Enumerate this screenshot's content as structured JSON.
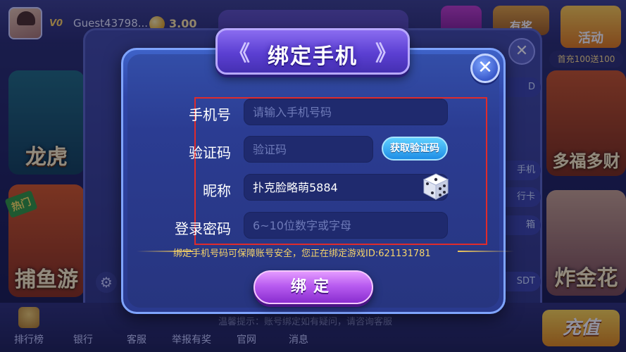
{
  "lobby": {
    "guest_name": "Guest43798...",
    "vip_label": "V0",
    "coins": "3.00",
    "tabs": {
      "activity": "活动",
      "first_recharge": "首充100送100",
      "prize": "有奖"
    },
    "games": {
      "dragon_tiger": "龙虎",
      "fishing": "捕鱼游",
      "fortune": "多福多财",
      "gold_flower": "炸金花",
      "hot_tag": "热门"
    },
    "side_pills": [
      "D",
      "手机",
      "行卡",
      "箱",
      "SDT"
    ],
    "bottom_nav": [
      "排行榜",
      "银行",
      "客服",
      "举报有奖",
      "官网",
      "消息"
    ],
    "recharge": "充值",
    "warm_hint": "温馨提示：账号绑定如有疑问，请咨询客服"
  },
  "dialog": {
    "title": "绑定手机",
    "close_symbol": "✕",
    "fields": {
      "phone": {
        "label": "手机号",
        "placeholder": "请输入手机号码",
        "value": ""
      },
      "code": {
        "label": "验证码",
        "placeholder": "验证码",
        "value": ""
      },
      "nickname": {
        "label": "昵称",
        "value": "扑克脸略萌5884"
      },
      "password": {
        "label": "登录密码",
        "placeholder": "6~10位数字或字母",
        "value": ""
      }
    },
    "get_code_button": "获取验证码",
    "notice": "绑定手机号码可保障账号安全，您正在绑定游戏ID:621131781",
    "submit_button": "绑定"
  },
  "colors": {
    "accent_purple": "#b85cf0",
    "notice_gold": "#f6d46a",
    "highlight_red": "#e02b2b",
    "input_bg": "#1f2a6e"
  }
}
